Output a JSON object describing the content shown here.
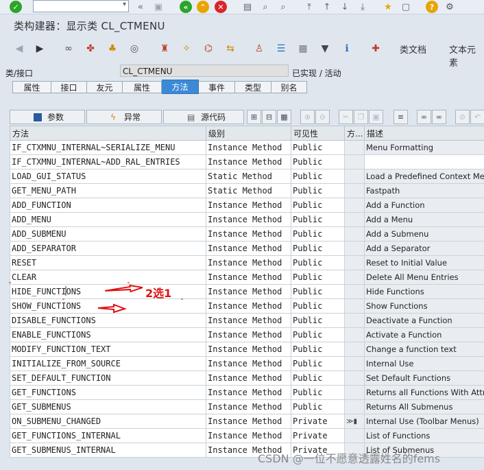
{
  "toolbar": {
    "icons": [
      "check-icon",
      "command-field",
      "double-left-icon",
      "save-icon",
      "back-icon",
      "exit-icon",
      "cancel-icon",
      "print-icon",
      "find-icon",
      "find-next-icon",
      "first-page-icon",
      "prev-page-icon",
      "next-page-icon",
      "last-page-icon",
      "bookmark-icon",
      "layout-icon",
      "help-icon",
      "settings-icon"
    ],
    "command_value": ""
  },
  "title": "类构建器：显示类 CL_CTMENU",
  "app_toolbar": {
    "class_docs_label": "类文档",
    "text_elements_label": "文本元素"
  },
  "header": {
    "class_label": "类/接口",
    "class_value": "CL_CTMENU",
    "status": "已实现 / 活动"
  },
  "tabs": [
    {
      "label": "属性"
    },
    {
      "label": "接口"
    },
    {
      "label": "友元"
    },
    {
      "label": "属性"
    },
    {
      "label": "方法",
      "active": true
    },
    {
      "label": "事件"
    },
    {
      "label": "类型"
    },
    {
      "label": "别名"
    }
  ],
  "grid_toolbar": {
    "params_label": "参数",
    "exceptions_label": "异常",
    "source_label": "源代码"
  },
  "columns": [
    "方法",
    "级别",
    "可见性",
    "方...",
    "描述"
  ],
  "rows": [
    {
      "method": "IF_CTXMNU_INTERNAL~SERIALIZE_MENU",
      "level": "Instance Method",
      "visibility": "Public",
      "flag": "",
      "desc": "Menu Formatting"
    },
    {
      "method": "IF_CTXMNU_INTERNAL~ADD_RAL_ENTRIES",
      "level": "Instance Method",
      "visibility": "Public",
      "flag": "",
      "desc": ""
    },
    {
      "method": "LOAD_GUI_STATUS",
      "level": "Static Method",
      "visibility": "Public",
      "flag": "",
      "desc": "Load a Predefined Context Menu"
    },
    {
      "method": "GET_MENU_PATH",
      "level": "Static Method",
      "visibility": "Public",
      "flag": "",
      "desc": "Fastpath"
    },
    {
      "method": "ADD_FUNCTION",
      "level": "Instance Method",
      "visibility": "Public",
      "flag": "",
      "desc": "Add a Function"
    },
    {
      "method": "ADD_MENU",
      "level": "Instance Method",
      "visibility": "Public",
      "flag": "",
      "desc": "Add a Menu"
    },
    {
      "method": "ADD_SUBMENU",
      "level": "Instance Method",
      "visibility": "Public",
      "flag": "",
      "desc": "Add a Submenu"
    },
    {
      "method": "ADD_SEPARATOR",
      "level": "Instance Method",
      "visibility": "Public",
      "flag": "",
      "desc": "Add a Separator"
    },
    {
      "method": "RESET",
      "level": "Instance Method",
      "visibility": "Public",
      "flag": "",
      "desc": "Reset to Initial Value"
    },
    {
      "method": "CLEAR",
      "level": "Instance Method",
      "visibility": "Public",
      "flag": "",
      "desc": "Delete All Menu Entries"
    },
    {
      "method": "HIDE_FUNCTIONS",
      "level": "Instance Method",
      "visibility": "Public",
      "flag": "",
      "desc": "Hide Functions"
    },
    {
      "method": "SHOW_FUNCTIONS",
      "level": "Instance Method",
      "visibility": "Public",
      "flag": "",
      "desc": "Show Functions"
    },
    {
      "method": "DISABLE_FUNCTIONS",
      "level": "Instance Method",
      "visibility": "Public",
      "flag": "",
      "desc": "Deactivate a Function"
    },
    {
      "method": "ENABLE_FUNCTIONS",
      "level": "Instance Method",
      "visibility": "Public",
      "flag": "",
      "desc": "Activate a Function"
    },
    {
      "method": "MODIFY_FUNCTION_TEXT",
      "level": "Instance Method",
      "visibility": "Public",
      "flag": "",
      "desc": "Change a function text"
    },
    {
      "method": "INITIALIZE_FROM_SOURCE",
      "level": "Instance Method",
      "visibility": "Public",
      "flag": "",
      "desc": "Internal Use"
    },
    {
      "method": "SET_DEFAULT_FUNCTION",
      "level": "Instance Method",
      "visibility": "Public",
      "flag": "",
      "desc": "Set Default Functions"
    },
    {
      "method": "GET_FUNCTIONS",
      "level": "Instance Method",
      "visibility": "Public",
      "flag": "",
      "desc": "Returns all Functions With Attributes"
    },
    {
      "method": "GET_SUBMENUS",
      "level": "Instance Method",
      "visibility": "Public",
      "flag": "",
      "desc": "Returns All Submenus"
    },
    {
      "method": "ON_SUBMENU_CHANGED",
      "level": "Instance Method",
      "visibility": "Private",
      "flag": "≫▮",
      "desc": "Internal Use (Toolbar Menus)"
    },
    {
      "method": "GET_FUNCTIONS_INTERNAL",
      "level": "Instance Method",
      "visibility": "Private",
      "flag": "",
      "desc": "List of Functions"
    },
    {
      "method": "GET_SUBMENUS_INTERNAL",
      "level": "Instance Method",
      "visibility": "Private",
      "flag": "",
      "desc": "List of Submenus"
    }
  ],
  "annotation": {
    "text": "2选1",
    "color": "#e01010"
  },
  "watermark": "CSDN @一位不愿意透露姓名的fems"
}
